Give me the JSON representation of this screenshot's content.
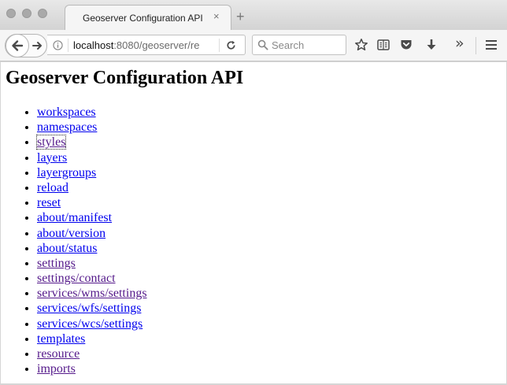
{
  "browser": {
    "tab": {
      "title": "Geoserver Configuration API",
      "close_glyph": "×"
    },
    "new_tab_glyph": "+",
    "url": {
      "host": "localhost",
      "rest": ":8080/geoserver/re"
    },
    "search": {
      "placeholder": "Search",
      "value": ""
    },
    "overflow_glyph": "»",
    "icons": [
      "back-arrow-icon",
      "forward-arrow-icon",
      "info-icon",
      "reload-icon",
      "search-icon",
      "bookmark-star-icon",
      "reader-view-icon",
      "pocket-icon",
      "download-icon",
      "overflow-chevron-icon",
      "hamburger-menu-icon"
    ],
    "colors": {
      "link": "#0000ee",
      "visited_link": "#551a8b",
      "chrome": "#f5f5f5"
    }
  },
  "page": {
    "title": "Geoserver Configuration API",
    "links": [
      {
        "label": "workspaces",
        "visited": false
      },
      {
        "label": "namespaces",
        "visited": false
      },
      {
        "label": "styles",
        "visited": true,
        "focused": true
      },
      {
        "label": "layers",
        "visited": false
      },
      {
        "label": "layergroups",
        "visited": false
      },
      {
        "label": "reload",
        "visited": false
      },
      {
        "label": "reset",
        "visited": false
      },
      {
        "label": "about/manifest",
        "visited": false
      },
      {
        "label": "about/version",
        "visited": false
      },
      {
        "label": "about/status",
        "visited": false
      },
      {
        "label": "settings",
        "visited": true
      },
      {
        "label": "settings/contact",
        "visited": true
      },
      {
        "label": "services/wms/settings",
        "visited": true
      },
      {
        "label": "services/wfs/settings",
        "visited": false
      },
      {
        "label": "services/wcs/settings",
        "visited": false
      },
      {
        "label": "templates",
        "visited": false
      },
      {
        "label": "resource",
        "visited": true
      },
      {
        "label": "imports",
        "visited": true
      }
    ]
  }
}
